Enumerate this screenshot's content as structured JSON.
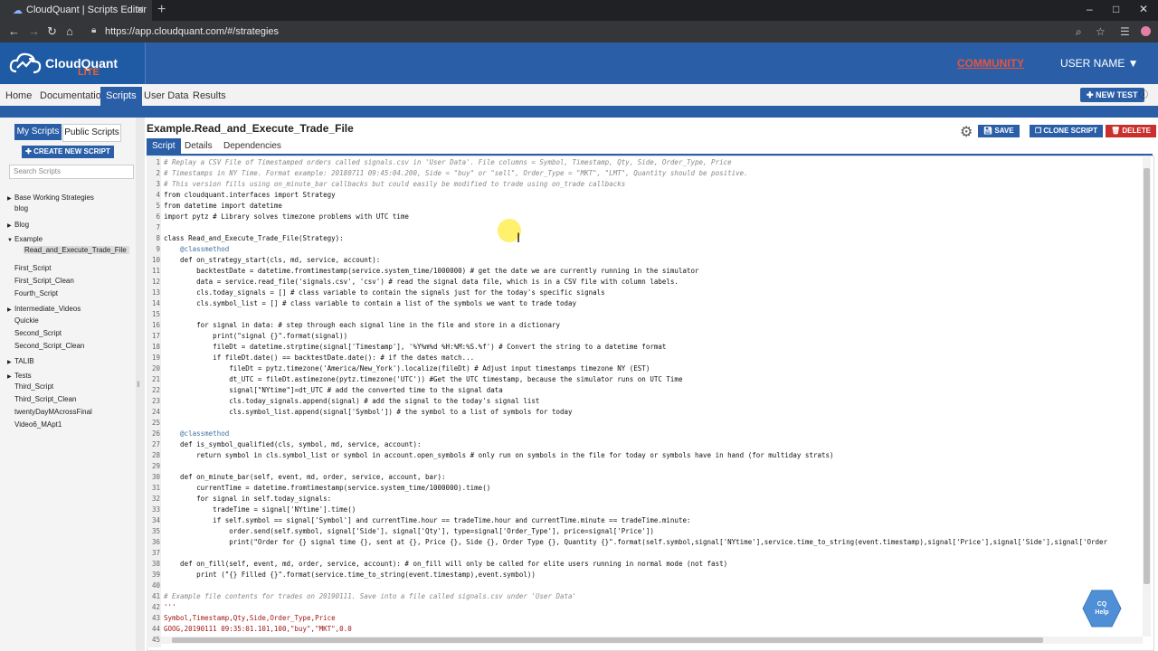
{
  "browser": {
    "tab_title": "CloudQuant | Scripts Editor",
    "url": "https://app.cloudquant.com/#/strategies"
  },
  "header": {
    "logo_name": "CloudQuant",
    "logo_sub": "LITE",
    "community": "COMMUNITY",
    "user": "USER NAME ▼"
  },
  "nav": {
    "items": [
      "Home",
      "Documentation",
      "Scripts",
      "User Data",
      "Results"
    ],
    "active": "Scripts",
    "new_test": "NEW TEST"
  },
  "sidebar": {
    "my_scripts": "My Scripts",
    "public_scripts": "Public Scripts",
    "create": "CREATE NEW SCRIPT",
    "search_placeholder": "Search Scripts",
    "tree": [
      {
        "label": "Base Working Strategies",
        "type": "folder-closed"
      },
      {
        "label": "blog",
        "type": "item"
      },
      {
        "label": "Blog",
        "type": "folder-closed"
      },
      {
        "label": "Example",
        "type": "folder-open"
      },
      {
        "label": "Read_and_Execute_Trade_File",
        "type": "selected"
      },
      {
        "label": "First_Script",
        "type": "item"
      },
      {
        "label": "First_Script_Clean",
        "type": "item"
      },
      {
        "label": "Fourth_Script",
        "type": "item"
      },
      {
        "label": "Intermediate_Videos",
        "type": "folder-closed"
      },
      {
        "label": "Quickie",
        "type": "item"
      },
      {
        "label": "Second_Script",
        "type": "item"
      },
      {
        "label": "Second_Script_Clean",
        "type": "item"
      },
      {
        "label": "TALIB",
        "type": "folder-closed"
      },
      {
        "label": "Tests",
        "type": "folder-closed"
      },
      {
        "label": "Third_Script",
        "type": "item"
      },
      {
        "label": "Third_Script_Clean",
        "type": "item"
      },
      {
        "label": "twentyDayMAcrossFinal",
        "type": "item"
      },
      {
        "label": "Video6_MApt1",
        "type": "item"
      }
    ]
  },
  "script": {
    "name": "Example.Read_and_Execute_Trade_File",
    "tabs": [
      "Script",
      "Details",
      "Dependencies"
    ],
    "active_tab": "Script",
    "save": "SAVE",
    "clone": "CLONE SCRIPT",
    "delete": "DELETE"
  },
  "help": {
    "line1": "CQ",
    "line2": "Help"
  },
  "code": [
    {
      "n": "1",
      "t": "# Replay a CSV File of Timestamped orders called signals.csv in 'User Data'. File columns = Symbol, Timestamp, Qty, Side, Order_Type, Price",
      "c": "cm"
    },
    {
      "n": "2",
      "t": "# Timestamps in NY Time. Format example: 20180711 09:45:04.200, Side = \"buy\" or \"sell\", Order_Type = \"MKT\", \"LMT\", Quantity should be positive.",
      "c": "cm"
    },
    {
      "n": "3",
      "t": "# This version fills using on_minute_bar callbacks but could easily be modified to trade using on_trade callbacks",
      "c": "cm"
    },
    {
      "n": "4",
      "t": "from cloudquant.interfaces import Strategy",
      "c": ""
    },
    {
      "n": "5",
      "t": "from datetime import datetime",
      "c": ""
    },
    {
      "n": "6",
      "t": "import pytz # Library solves timezone problems with UTC time",
      "c": ""
    },
    {
      "n": "7",
      "t": "",
      "c": ""
    },
    {
      "n": "8",
      "t": "class Read_and_Execute_Trade_File(Strategy):",
      "c": ""
    },
    {
      "n": "9",
      "t": "    @classmethod",
      "c": "sf"
    },
    {
      "n": "10",
      "t": "    def on_strategy_start(cls, md, service, account):",
      "c": ""
    },
    {
      "n": "11",
      "t": "        backtestDate = datetime.fromtimestamp(service.system_time/1000000) # get the date we are currently running in the simulator",
      "c": ""
    },
    {
      "n": "12",
      "t": "        data = service.read_file('signals.csv', 'csv') # read the signal data file, which is in a CSV file with column labels.",
      "c": ""
    },
    {
      "n": "13",
      "t": "        cls.today_signals = [] # class variable to contain the signals just for the today's specific signals",
      "c": ""
    },
    {
      "n": "14",
      "t": "        cls.symbol_list = [] # class variable to contain a list of the symbols we want to trade today",
      "c": ""
    },
    {
      "n": "15",
      "t": "",
      "c": ""
    },
    {
      "n": "16",
      "t": "        for signal in data: # step through each signal line in the file and store in a dictionary",
      "c": ""
    },
    {
      "n": "17",
      "t": "            print(\"signal {}\".format(signal))",
      "c": ""
    },
    {
      "n": "18",
      "t": "            fileDt = datetime.strptime(signal['Timestamp'], '%Y%m%d %H:%M:%S.%f') # Convert the string to a datetime format",
      "c": ""
    },
    {
      "n": "19",
      "t": "            if fileDt.date() == backtestDate.date(): # if the dates match...",
      "c": ""
    },
    {
      "n": "20",
      "t": "                fileDt = pytz.timezone('America/New_York').localize(fileDt) # Adjust input timestamps timezone NY (EST)",
      "c": ""
    },
    {
      "n": "21",
      "t": "                dt_UTC = fileDt.astimezone(pytz.timezone('UTC')) #Get the UTC timestamp, because the simulator runs on UTC Time",
      "c": ""
    },
    {
      "n": "22",
      "t": "                signal[\"NYtime\"]=dt_UTC # add the converted time to the signal data",
      "c": ""
    },
    {
      "n": "23",
      "t": "                cls.today_signals.append(signal) # add the signal to the today's signal list",
      "c": ""
    },
    {
      "n": "24",
      "t": "                cls.symbol_list.append(signal['Symbol']) # the symbol to a list of symbols for today",
      "c": ""
    },
    {
      "n": "25",
      "t": "",
      "c": ""
    },
    {
      "n": "26",
      "t": "    @classmethod",
      "c": "sf"
    },
    {
      "n": "27",
      "t": "    def is_symbol_qualified(cls, symbol, md, service, account):",
      "c": ""
    },
    {
      "n": "28",
      "t": "        return symbol in cls.symbol_list or symbol in account.open_symbols # only run on symbols in the file for today or symbols have in hand (for multiday strats)",
      "c": ""
    },
    {
      "n": "29",
      "t": "",
      "c": ""
    },
    {
      "n": "30",
      "t": "    def on_minute_bar(self, event, md, order, service, account, bar):",
      "c": ""
    },
    {
      "n": "31",
      "t": "        currentTime = datetime.fromtimestamp(service.system_time/1000000).time()",
      "c": ""
    },
    {
      "n": "32",
      "t": "        for signal in self.today_signals:",
      "c": ""
    },
    {
      "n": "33",
      "t": "            tradeTime = signal['NYtime'].time()",
      "c": ""
    },
    {
      "n": "34",
      "t": "            if self.symbol == signal['Symbol'] and currentTime.hour == tradeTime.hour and currentTime.minute == tradeTime.minute:",
      "c": ""
    },
    {
      "n": "35",
      "t": "                order.send(self.symbol, signal['Side'], signal['Qty'], type=signal['Order_Type'], price=signal['Price'])",
      "c": ""
    },
    {
      "n": "36",
      "t": "                print(\"Order for {} signal time {}, sent at {}, Price {}, Side {}, Order Type {}, Quantity {}\".format(self.symbol,signal['NYtime'],service.time_to_string(event.timestamp),signal['Price'],signal['Side'],signal['Order",
      "c": ""
    },
    {
      "n": "37",
      "t": "",
      "c": ""
    },
    {
      "n": "38",
      "t": "    def on_fill(self, event, md, order, service, account): # on_fill will only be called for elite users running in normal mode (not fast)",
      "c": ""
    },
    {
      "n": "39",
      "t": "        print (\"{} Filled {}\".format(service.time_to_string(event.timestamp),event.symbol))",
      "c": ""
    },
    {
      "n": "40",
      "t": "",
      "c": ""
    },
    {
      "n": "41",
      "t": "# Example file contents for trades on 20190111. Save into a file called signals.csv under 'User Data'",
      "c": "cm"
    },
    {
      "n": "42",
      "t": "'''",
      "c": "sl"
    },
    {
      "n": "43",
      "t": "Symbol,Timestamp,Qty,Side,Order_Type,Price",
      "c": "sl"
    },
    {
      "n": "44",
      "t": "GOOG,20190111 09:35:01.101,100,\"buy\",\"MKT\",0.0",
      "c": "sl"
    },
    {
      "n": "45",
      "t": "",
      "c": ""
    }
  ]
}
